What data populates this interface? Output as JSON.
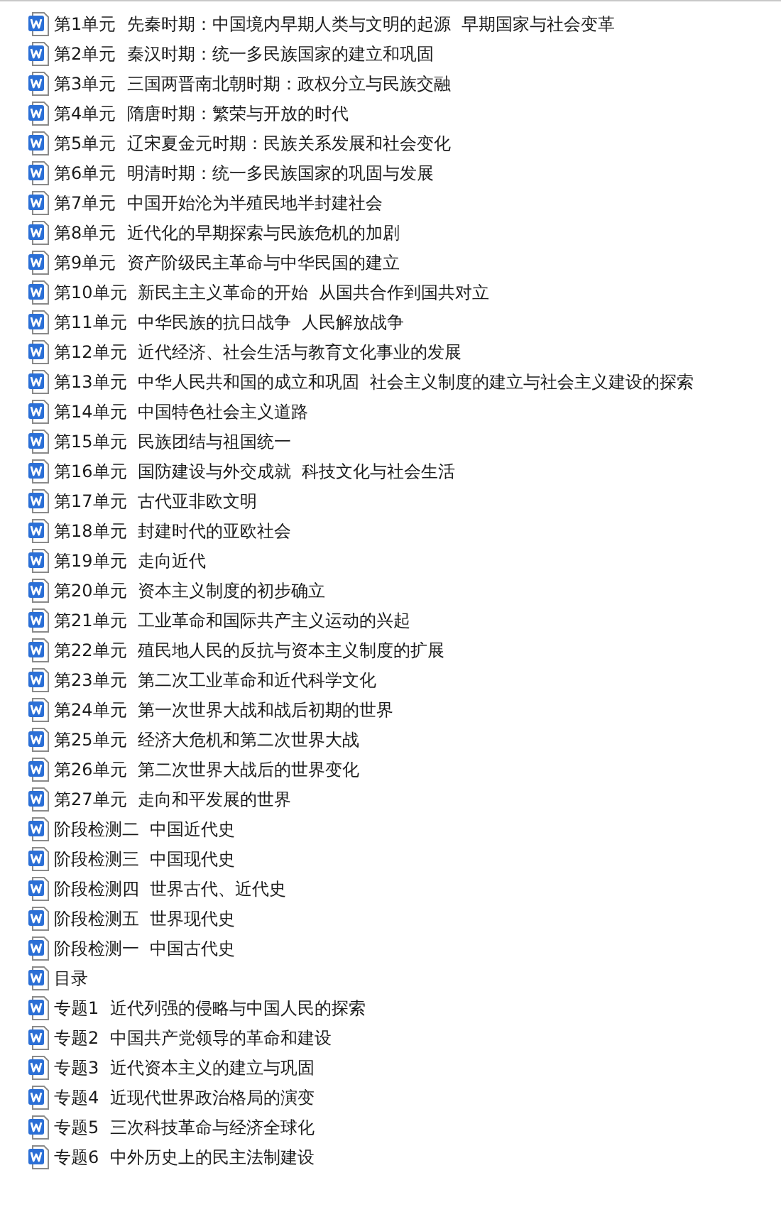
{
  "files": [
    {
      "name": "第1单元  先秦时期：中国境内早期人类与文明的起源  早期国家与社会变革"
    },
    {
      "name": "第2单元  秦汉时期：统一多民族国家的建立和巩固"
    },
    {
      "name": "第3单元  三国两晋南北朝时期：政权分立与民族交融"
    },
    {
      "name": "第4单元  隋唐时期：繁荣与开放的时代"
    },
    {
      "name": "第5单元  辽宋夏金元时期：民族关系发展和社会变化"
    },
    {
      "name": "第6单元  明清时期：统一多民族国家的巩固与发展"
    },
    {
      "name": "第7单元  中国开始沦为半殖民地半封建社会"
    },
    {
      "name": "第8单元  近代化的早期探索与民族危机的加剧"
    },
    {
      "name": "第9单元  资产阶级民主革命与中华民国的建立"
    },
    {
      "name": "第10单元  新民主主义革命的开始  从国共合作到国共对立"
    },
    {
      "name": "第11单元  中华民族的抗日战争  人民解放战争"
    },
    {
      "name": "第12单元  近代经济、社会生活与教育文化事业的发展"
    },
    {
      "name": "第13单元  中华人民共和国的成立和巩固  社会主义制度的建立与社会主义建设的探索"
    },
    {
      "name": "第14单元  中国特色社会主义道路"
    },
    {
      "name": "第15单元  民族团结与祖国统一"
    },
    {
      "name": "第16单元  国防建设与外交成就  科技文化与社会生活"
    },
    {
      "name": "第17单元  古代亚非欧文明"
    },
    {
      "name": "第18单元  封建时代的亚欧社会"
    },
    {
      "name": "第19单元  走向近代"
    },
    {
      "name": "第20单元  资本主义制度的初步确立"
    },
    {
      "name": "第21单元  工业革命和国际共产主义运动的兴起"
    },
    {
      "name": "第22单元  殖民地人民的反抗与资本主义制度的扩展"
    },
    {
      "name": "第23单元  第二次工业革命和近代科学文化"
    },
    {
      "name": "第24单元  第一次世界大战和战后初期的世界"
    },
    {
      "name": "第25单元  经济大危机和第二次世界大战"
    },
    {
      "name": "第26单元  第二次世界大战后的世界变化"
    },
    {
      "name": "第27单元  走向和平发展的世界"
    },
    {
      "name": "阶段检测二  中国近代史"
    },
    {
      "name": "阶段检测三  中国现代史"
    },
    {
      "name": "阶段检测四  世界古代、近代史"
    },
    {
      "name": "阶段检测五  世界现代史"
    },
    {
      "name": "阶段检测一  中国古代史"
    },
    {
      "name": "目录"
    },
    {
      "name": "专题1  近代列强的侵略与中国人民的探索"
    },
    {
      "name": "专题2  中国共产党领导的革命和建设"
    },
    {
      "name": "专题3  近代资本主义的建立与巩固"
    },
    {
      "name": "专题4  近现代世界政治格局的演变"
    },
    {
      "name": "专题5  三次科技革命与经济全球化"
    },
    {
      "name": "专题6  中外历史上的民主法制建设"
    }
  ]
}
